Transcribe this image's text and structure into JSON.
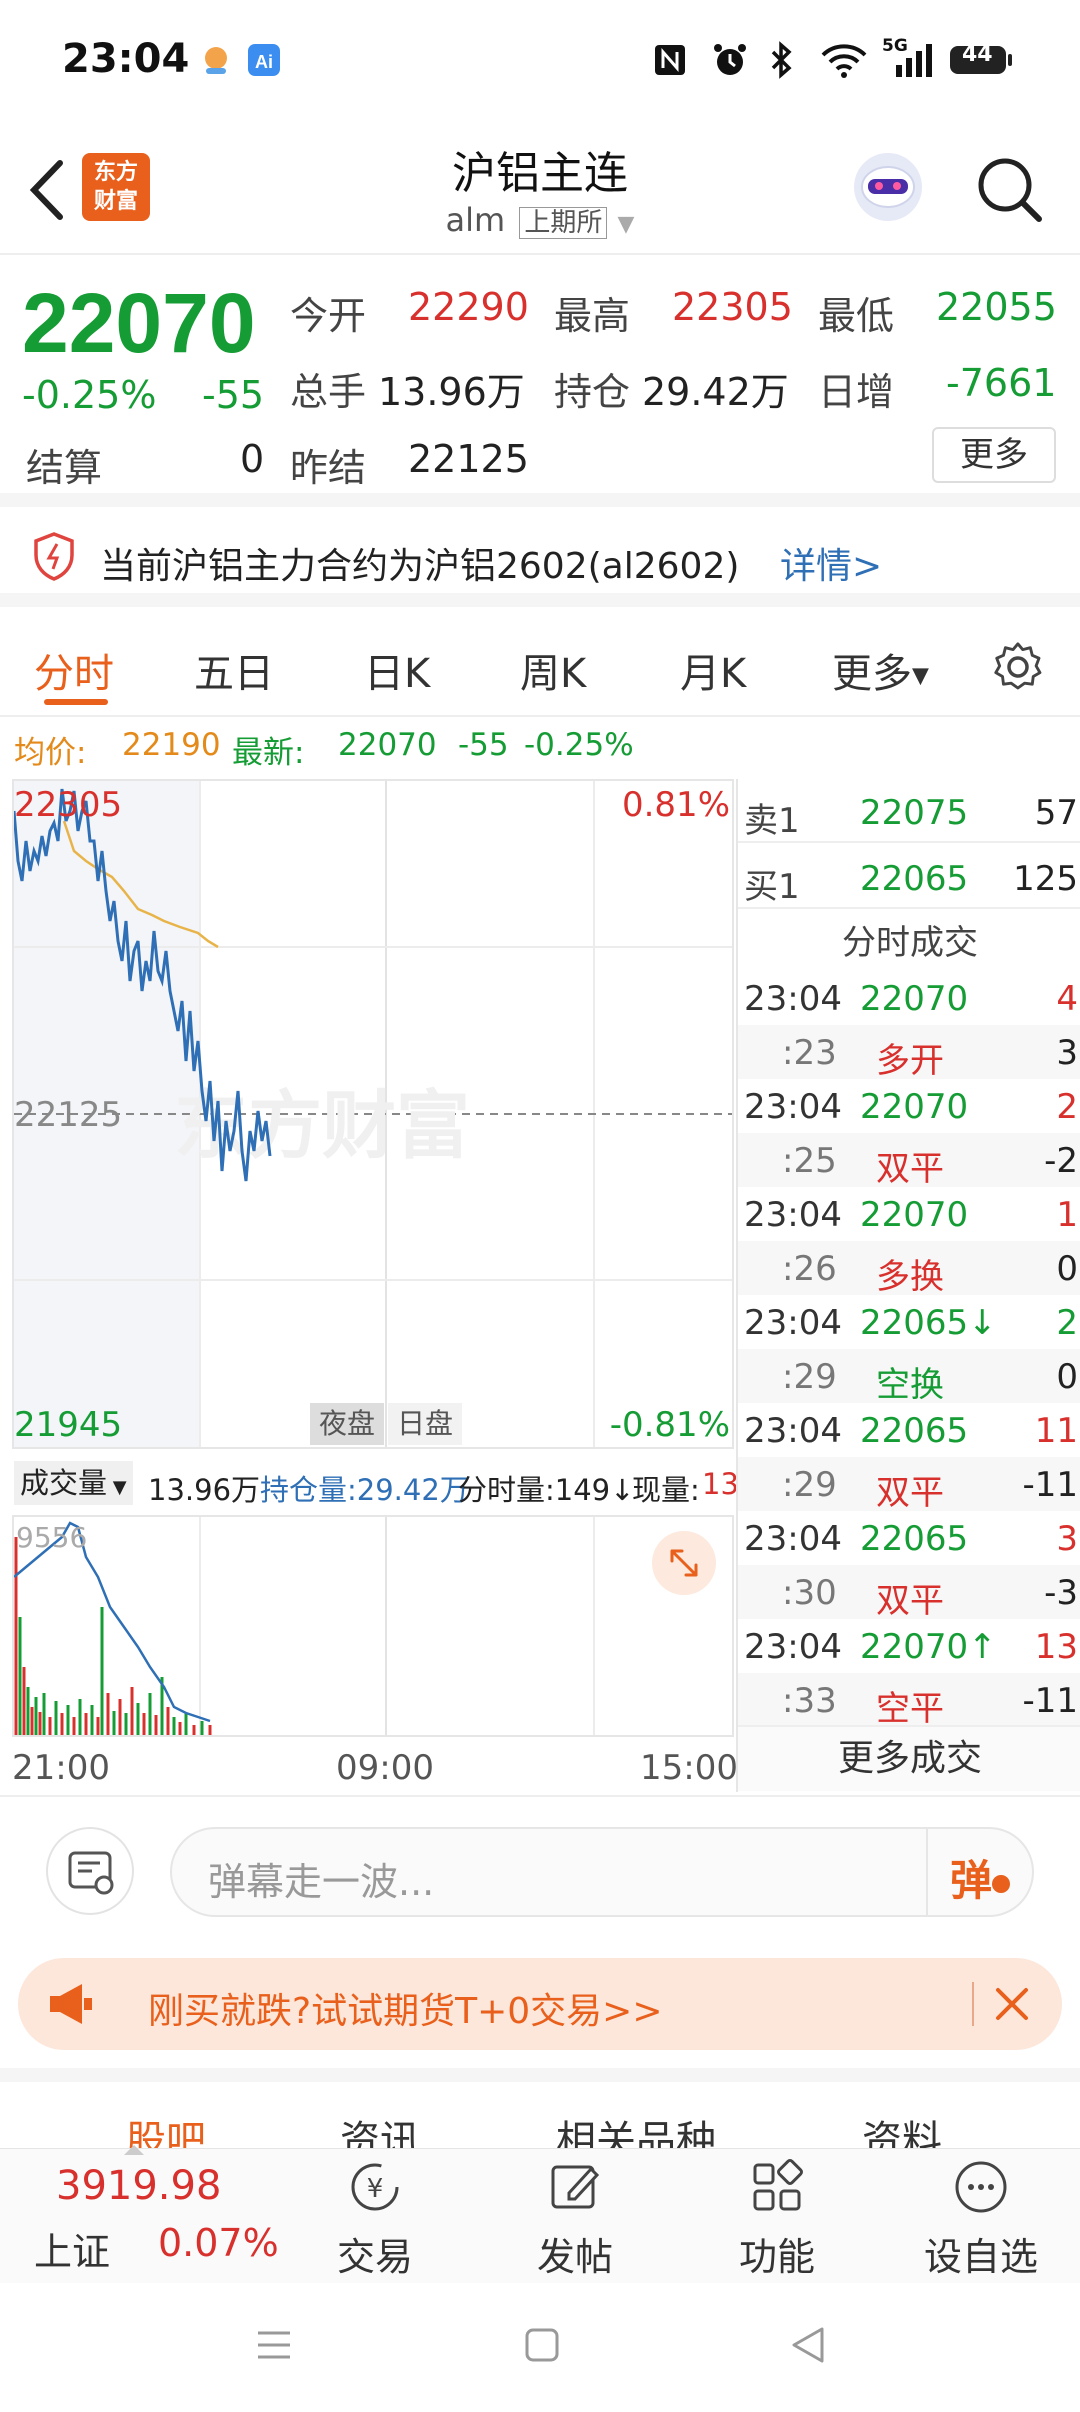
{
  "status_bar": {
    "time": "23:04",
    "network": "5G",
    "battery": "44"
  },
  "header": {
    "title": "沪铝主连",
    "code": "alm",
    "exchange": "上期所",
    "logo_text": "东方财富"
  },
  "quote": {
    "price": "22070",
    "change_pct": "-0.25%",
    "change": "-55",
    "settle_label": "结算",
    "settle_value": "0",
    "open_label": "今开",
    "open_value": "22290",
    "high_label": "最高",
    "high_value": "22305",
    "low_label": "最低",
    "low_value": "22055",
    "volume_label": "总手",
    "volume_value": "13.96万",
    "oi_label": "持仓",
    "oi_value": "29.42万",
    "daily_inc_label": "日增",
    "daily_inc_value": "-7661",
    "prev_settle_label": "昨结",
    "prev_settle_value": "22125",
    "more_button": "更多"
  },
  "notice": {
    "text": "当前沪铝主力合约为沪铝2602(al2602)",
    "link": "详情>"
  },
  "tabs": [
    "分时",
    "五日",
    "日K",
    "周K",
    "月K",
    "更多"
  ],
  "infoline": {
    "avg_label": "均价:",
    "avg_value": "22190",
    "latest_label": "最新:",
    "latest_value": "22070",
    "change": "-55",
    "pct": "-0.25%"
  },
  "chart_labels": {
    "top_price": "22305",
    "top_pct": "0.81%",
    "mid_price": "22125",
    "bottom_price": "21945",
    "bottom_pct": "-0.81%",
    "night": "夜盘",
    "day": "日盘",
    "watermark": "东方财富"
  },
  "volume_bar": {
    "select": "成交量",
    "vol": "13.96万",
    "oi": "持仓量:29.42万",
    "tick": "分时量:149↓",
    "now_label": "现量:",
    "now_value": "13",
    "vmax": "9556"
  },
  "time_axis": [
    "21:00",
    "09:00",
    "15:00"
  ],
  "orderbook": {
    "sell1_label": "卖1",
    "sell1_price": "22075",
    "sell1_vol": "57",
    "buy1_label": "买1",
    "buy1_price": "22065",
    "buy1_vol": "125",
    "trades_title": "分时成交",
    "trades": [
      {
        "time": "23:04",
        "sec": ":23",
        "price": "22070",
        "vol": "4",
        "type": "多开",
        "oi": "3"
      },
      {
        "time": "23:04",
        "sec": ":25",
        "price": "22070",
        "vol": "2",
        "type": "双平",
        "oi": "-2"
      },
      {
        "time": "23:04",
        "sec": ":26",
        "price": "22070",
        "vol": "1",
        "type": "多换",
        "oi": "0"
      },
      {
        "time": "23:04",
        "sec": ":29",
        "price": "22065↓",
        "vol": "2",
        "type": "空换",
        "oi": "0"
      },
      {
        "time": "23:04",
        "sec": ":29",
        "price": "22065",
        "vol": "11",
        "type": "双平",
        "oi": "-11"
      },
      {
        "time": "23:04",
        "sec": ":30",
        "price": "22065",
        "vol": "3",
        "type": "双平",
        "oi": "-3"
      },
      {
        "time": "23:04",
        "sec": ":33",
        "price": "22070↑",
        "vol": "13",
        "type": "空平",
        "oi": "-11"
      }
    ],
    "more": "更多成交"
  },
  "danmu": {
    "placeholder": "弹幕走一波...",
    "button": "弹"
  },
  "promo": {
    "text": "刚买就跌?试试期货T+0交易>>"
  },
  "bottom_tabs": [
    "股吧",
    "资讯",
    "相关品种",
    "资料"
  ],
  "bottom_nav": {
    "index_value": "3919.98",
    "index_name": "上证",
    "index_pct": "0.07%",
    "items": [
      "交易",
      "发帖",
      "功能",
      "设自选"
    ]
  },
  "colors": {
    "up": "#d8302c",
    "down": "#169c35",
    "accent": "#e8601c",
    "line": "#2f6fb5",
    "avg": "#e8b44a"
  }
}
